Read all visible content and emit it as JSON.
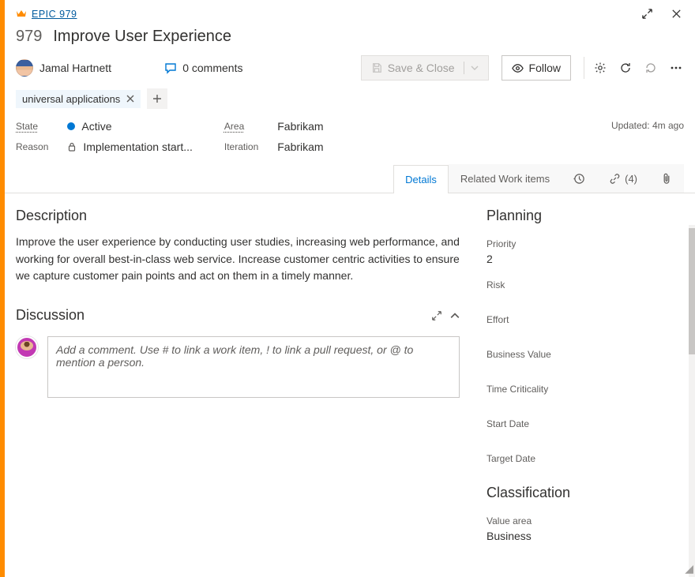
{
  "breadcrumb": {
    "type_label": "EPIC 979"
  },
  "title": {
    "id": "979",
    "text": "Improve User Experience"
  },
  "assignee": {
    "name": "Jamal Hartnett"
  },
  "comments": {
    "count_label": "0 comments"
  },
  "actions": {
    "save_label": "Save & Close",
    "follow_label": "Follow"
  },
  "tags": [
    {
      "label": "universal applications"
    }
  ],
  "meta": {
    "state_label": "State",
    "state_value": "Active",
    "reason_label": "Reason",
    "reason_value": "Implementation start...",
    "area_label": "Area",
    "area_value": "Fabrikam",
    "iteration_label": "Iteration",
    "iteration_value": "Fabrikam",
    "updated": "Updated: 4m ago"
  },
  "tabs": {
    "details": "Details",
    "related": "Related Work items",
    "links_count": "(4)"
  },
  "description": {
    "heading": "Description",
    "body": "Improve the user experience by conducting user studies, increasing web performance, and working for overall best-in-class web service. Increase customer centric activities to ensure we capture customer pain points and act on them in a timely manner."
  },
  "discussion": {
    "heading": "Discussion",
    "placeholder": "Add a comment. Use # to link a work item, ! to link a pull request, or @ to mention a person."
  },
  "planning": {
    "heading": "Planning",
    "priority_label": "Priority",
    "priority_value": "2",
    "risk_label": "Risk",
    "effort_label": "Effort",
    "business_value_label": "Business Value",
    "time_criticality_label": "Time Criticality",
    "start_date_label": "Start Date",
    "target_date_label": "Target Date"
  },
  "classification": {
    "heading": "Classification",
    "value_area_label": "Value area",
    "value_area_value": "Business"
  }
}
